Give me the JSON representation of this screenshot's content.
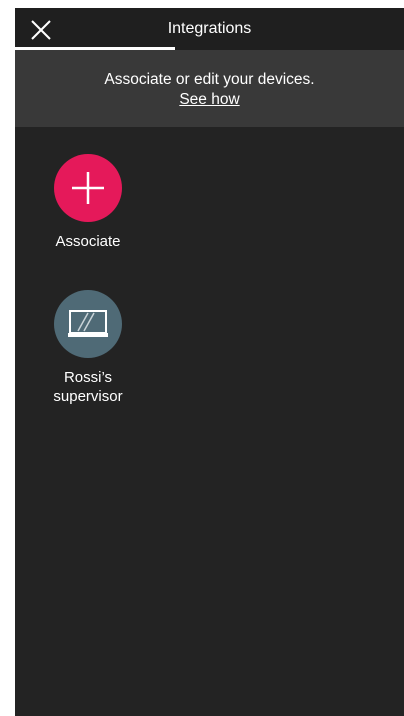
{
  "header": {
    "title": "Integrations",
    "close_icon": "close-icon"
  },
  "banner": {
    "text": "Associate or edit your devices.",
    "link": "See how"
  },
  "devices": [
    {
      "label": "Associate",
      "icon": "plus-icon",
      "color": "#e5195a"
    },
    {
      "label_line1": "Rossi’s",
      "label_line2": "supervisor",
      "icon": "monitor-icon",
      "color": "#4f6a76"
    }
  ],
  "colors": {
    "background": "#232323",
    "banner": "#393939",
    "accent": "#e5195a"
  }
}
